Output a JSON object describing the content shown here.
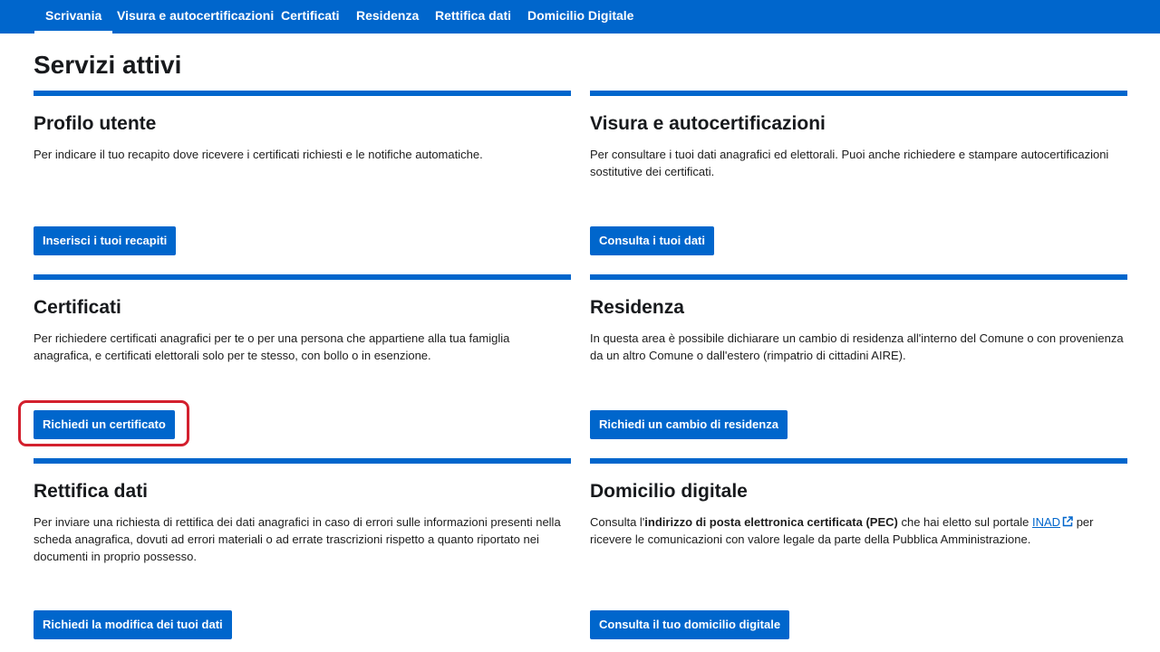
{
  "nav": {
    "items": [
      {
        "label": "Scrivania",
        "active": true
      },
      {
        "label": "Visura e autocertificazioni",
        "active": false
      },
      {
        "label": "Certificati",
        "active": false
      },
      {
        "label": "Residenza",
        "active": false
      },
      {
        "label": "Rettifica dati",
        "active": false
      },
      {
        "label": "Domicilio Digitale",
        "active": false
      }
    ]
  },
  "page": {
    "title": "Servizi attivi"
  },
  "cards": [
    {
      "title": "Profilo utente",
      "description": "Per indicare il tuo recapito dove ricevere i certificati richiesti e le notifiche automatiche.",
      "button": "Inserisci i tuoi recapiti"
    },
    {
      "title": "Visura e autocertificazioni",
      "description": "Per consultare i tuoi dati anagrafici ed elettorali. Puoi anche richiedere e stampare autocertificazioni sostitutive dei certificati.",
      "button": "Consulta i tuoi dati"
    },
    {
      "title": "Certificati",
      "description": "Per richiedere certificati anagrafici per te o per una persona che appartiene alla tua famiglia anagrafica, e certificati elettorali solo per te stesso, con bollo o in esenzione.",
      "button": "Richiedi un certificato"
    },
    {
      "title": "Residenza",
      "description": "In questa area è possibile dichiarare un cambio di residenza all'interno del Comune o con provenienza da un altro Comune o dall'estero (rimpatrio di cittadini AIRE).",
      "button": "Richiedi un cambio di residenza"
    },
    {
      "title": "Rettifica dati",
      "description": "Per inviare una richiesta di rettifica dei dati anagrafici in caso di errori sulle informazioni presenti nella scheda anagrafica, dovuti ad errori materiali o ad errate trascrizioni rispetto a quanto riportato nei documenti in proprio possesso.",
      "button": "Richiedi la modifica dei tuoi dati"
    },
    {
      "title": "Domicilio digitale",
      "description_parts": {
        "pre": "Consulta l'",
        "bold": "indirizzo di posta elettronica certificata (PEC)",
        "mid": " che hai eletto sul portale ",
        "link": "INAD",
        "post": " per ricevere le comunicazioni con valore legale da parte della Pubblica Amministrazione."
      },
      "link_icon": "external-link-icon",
      "button": "Consulta il tuo domicilio digitale"
    }
  ],
  "colors": {
    "primary": "#0066cc",
    "highlight": "#d3202e"
  }
}
